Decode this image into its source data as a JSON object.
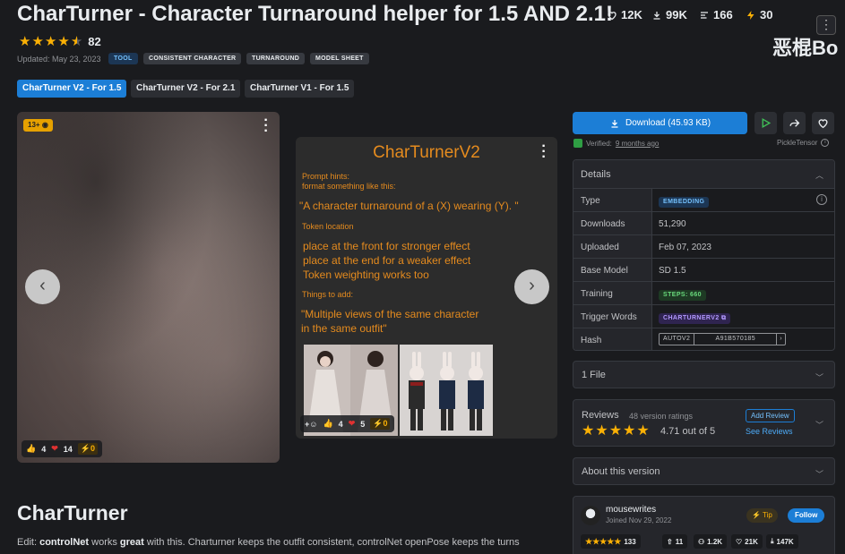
{
  "header": {
    "title": "CharTurner - Character Turnaround helper for 1.5 AND 2.1!",
    "stats": {
      "likes": "12K",
      "downloads": "99K",
      "comments": "166",
      "buzz": "30"
    },
    "menu_label": "⋮",
    "overlay_text": "恶棍Bo",
    "rating_count": "82",
    "rating_stars": 4.5,
    "updated": "Updated: May 23, 2023",
    "tags": [
      "TOOL",
      "CONSISTENT CHARACTER",
      "TURNAROUND",
      "MODEL SHEET"
    ]
  },
  "version_tabs": [
    "CharTurner V2 - For 1.5",
    "CharTurner V2 - For 2.1",
    "CharTurner V1 - For 1.5"
  ],
  "gallery": {
    "card1": {
      "badge": "13+",
      "reactions": {
        "thumbs": "4",
        "hearts": "14",
        "buzz": "0"
      }
    },
    "card2": {
      "title": "CharTurnerV2",
      "hint_heading": "Prompt hints:",
      "hint_sub": "format something like this:",
      "hint_quote": "\"A character turnaround of a (X) wearing (Y). \"",
      "token_heading": "Token location",
      "token_lines": [
        "place at the front for stronger effect",
        "place at the end for a weaker effect",
        "Token weighting works too"
      ],
      "things_heading": "Things to add:",
      "things_lines": [
        "\"Multiple views of the same character",
        "in the same outfit\""
      ],
      "reactions": {
        "smile": "+",
        "thumbs": "4",
        "hearts": "5",
        "buzz": "0"
      }
    }
  },
  "download": {
    "button_label": "Download (45.93 KB)",
    "verified_label": "Verified:",
    "verified_time": "9 months ago",
    "scanner": "PickleTensor"
  },
  "details": {
    "heading": "Details",
    "rows": {
      "type": {
        "label": "Type",
        "value": "EMBEDDING"
      },
      "downloads": {
        "label": "Downloads",
        "value": "51,290"
      },
      "uploaded": {
        "label": "Uploaded",
        "value": "Feb 07, 2023"
      },
      "base_model": {
        "label": "Base Model",
        "value": "SD 1.5"
      },
      "training": {
        "label": "Training",
        "value": "STEPS: 660"
      },
      "trigger": {
        "label": "Trigger Words",
        "value": "CHARTURNERV2"
      },
      "hash": {
        "label": "Hash",
        "algo": "AUTOV2",
        "value": "A91B570185"
      }
    }
  },
  "files": {
    "label": "1 File"
  },
  "reviews": {
    "heading": "Reviews",
    "count": "48 version ratings",
    "score": "4.71 out of 5",
    "add_label": "Add Review",
    "see_label": "See Reviews"
  },
  "about": {
    "label": "About this version"
  },
  "creator": {
    "name": "mousewrites",
    "joined": "Joined Nov 29, 2022",
    "tip_label": "Tip",
    "follow_label": "Follow",
    "rating": "133",
    "uploads": "11",
    "followers": "1.2K",
    "likes": "21K",
    "downloads": "147K"
  },
  "description": {
    "heading": "CharTurner",
    "p_edit": "Edit: ",
    "p_controlnet": "controlNet",
    "p_works": " works ",
    "p_great": "great",
    "p_rest": " with this. Charturner keeps the outfit consistent, controlNet openPose keeps the turns"
  },
  "colors": {
    "accent": "#1c7ed6",
    "star": "#fab005",
    "orange_text": "#e58b1e"
  }
}
